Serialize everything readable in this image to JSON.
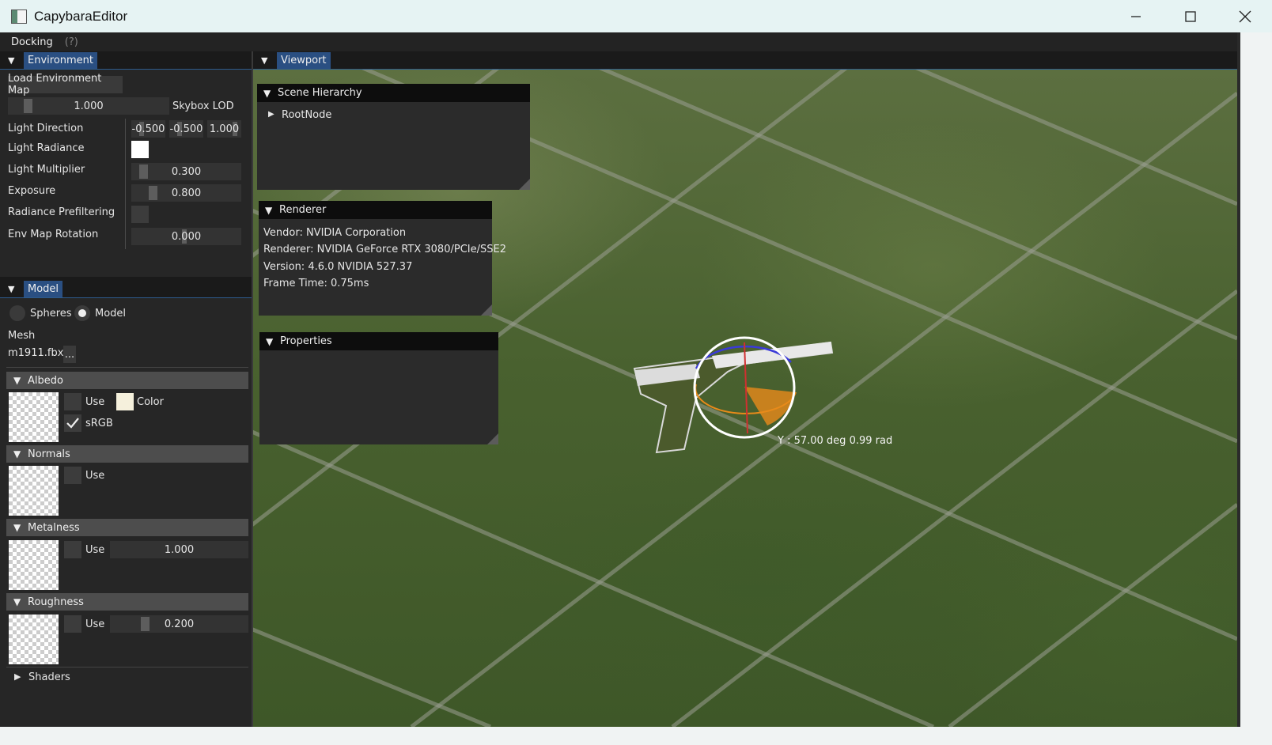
{
  "window": {
    "title": "CapybaraEditor",
    "controls": [
      "minimize",
      "maximize",
      "close"
    ]
  },
  "menu": {
    "docking": "Docking",
    "help": "(?)"
  },
  "environment": {
    "tab": "Environment",
    "load_button": "Load Environment Map",
    "skybox_lod_value": "1.000",
    "skybox_lod_label": "Skybox LOD",
    "light_direction_label": "Light Direction",
    "light_direction": [
      "-0.500",
      "-0.500",
      "1.000"
    ],
    "light_radiance_label": "Light Radiance",
    "light_multiplier_label": "Light Multiplier",
    "light_multiplier_value": "0.300",
    "exposure_label": "Exposure",
    "exposure_value": "0.800",
    "radiance_prefiltering_label": "Radiance Prefiltering",
    "env_map_rotation_label": "Env Map Rotation",
    "env_map_rotation_value": "0.000"
  },
  "model": {
    "tab": "Model",
    "radio_spheres": "Spheres",
    "radio_model": "Model",
    "mesh_label": "Mesh",
    "mesh_file": "m1911.fbx",
    "browse": "...",
    "albedo": {
      "header": "Albedo",
      "use": "Use",
      "color": "Color",
      "srgb": "sRGB"
    },
    "normals": {
      "header": "Normals",
      "use": "Use"
    },
    "metalness": {
      "header": "Metalness",
      "use": "Use",
      "value": "1.000"
    },
    "roughness": {
      "header": "Roughness",
      "use": "Use",
      "value": "0.200"
    },
    "shaders": "Shaders"
  },
  "viewport": {
    "tab": "Viewport",
    "gizmo_readout": "Y : 57.00 deg  0.99 rad"
  },
  "scene_hierarchy": {
    "title": "Scene Hierarchy",
    "root": "RootNode"
  },
  "renderer": {
    "title": "Renderer",
    "vendor": "Vendor: NVIDIA Corporation",
    "renderer": "Renderer: NVIDIA GeForce RTX 3080/PCIe/SSE2",
    "version": "Version: 4.6.0 NVIDIA 527.37",
    "frame_time": "Frame Time: 0.75ms"
  },
  "properties": {
    "title": "Properties"
  },
  "colors": {
    "accent": "#2a4f82",
    "panel": "#262626",
    "titlebar": "#e6f3f3",
    "albedo_color": "#f5f0dc",
    "gizmo_orange": "#e88a1a"
  }
}
